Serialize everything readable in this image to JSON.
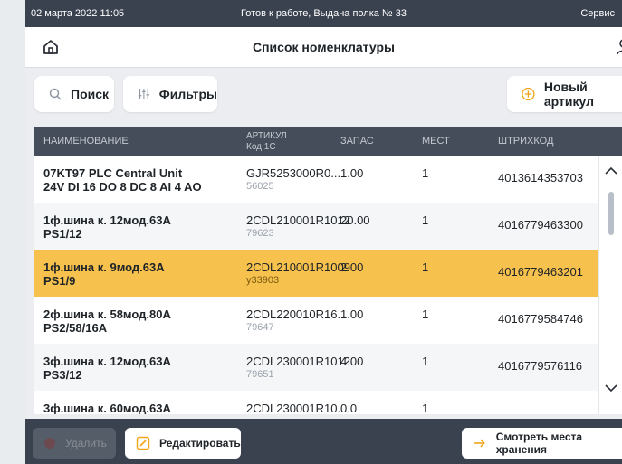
{
  "status": {
    "datetime": "02 марта 2022 11:05",
    "message": "Готов к работе, Выдана полка № 33",
    "right": "Сервис"
  },
  "appbar": {
    "title": "Список номенклатуры"
  },
  "toolbar": {
    "search_label": "Поиск",
    "filters_label": "Фильтры",
    "new_label": "Новый артикул"
  },
  "table": {
    "headers": {
      "name": "НАИМЕНОВАНИЕ",
      "article": "АРТИКУЛ",
      "article_sub": "Код 1С",
      "stock": "ЗАПАС",
      "places": "МЕСТ",
      "barcode": "ШТРИХКОД"
    },
    "rows": [
      {
        "name1": "07KT97 PLC Central Unit",
        "name2": "24V DI 16 DO 8 DC 8 AI 4 AO",
        "article": "GJR5253000R0...",
        "code": "56025",
        "stock": "1.00",
        "places": "1",
        "barcode": "4013614353703"
      },
      {
        "name1": "1ф.шина к. 12мод.63A",
        "name2": "PS1/12",
        "article": "2CDL210001R1012",
        "code": "79623",
        "stock": "20.00",
        "places": "1",
        "barcode": "4016779463300"
      },
      {
        "name1": "1ф.шина к. 9мод.63A",
        "name2": "PS1/9",
        "article": "2CDL210001R1009",
        "code": "у33903",
        "stock": "2.00",
        "places": "1",
        "barcode": "4016779463201"
      },
      {
        "name1": "2ф.шина к. 58мод.80A",
        "name2": "PS2/58/16A",
        "article": "2CDL220010R16...",
        "code": "79647",
        "stock": "1.00",
        "places": "1",
        "barcode": "4016779584746"
      },
      {
        "name1": "3ф.шина к. 12мод.63A",
        "name2": "PS3/12",
        "article": "2CDL230001R1012",
        "code": "79651",
        "stock": "4.00",
        "places": "1",
        "barcode": "4016779576116"
      },
      {
        "name1": "3ф.шина к. 60мод.63A",
        "name2": "",
        "article": "2CDL230001R10...",
        "code": "",
        "stock": "0.0",
        "places": "1",
        "barcode": ""
      }
    ]
  },
  "bottom": {
    "delete_label": "Удалить",
    "edit_label": "Редактировать",
    "view_label": "Смотреть места хранения"
  },
  "colors": {
    "accent": "#f6c14c",
    "dark": "#3a4250",
    "header": "#454d5a"
  }
}
